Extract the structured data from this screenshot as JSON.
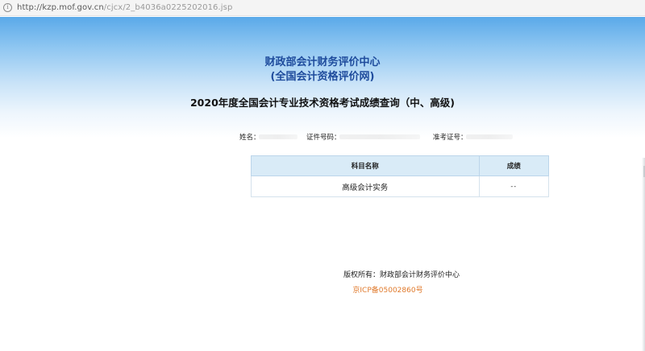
{
  "browser": {
    "url_host": "http://kzp.mof.gov.cn",
    "url_path": "/cjcx/2_b4036a0225202016.jsp"
  },
  "header": {
    "org_line1": "财政部会计财务评价中心",
    "org_line2": "(全国会计资格评价网)",
    "title": "2020年度全国会计专业技术资格考试成绩查询（中、高级)"
  },
  "candidate": {
    "name_label": "姓名：",
    "id_label": "证件号码：",
    "ticket_label": "准考证号："
  },
  "table": {
    "headers": [
      "科目名称",
      "成绩"
    ],
    "rows": [
      {
        "subject": "高级会计实务",
        "score": "--"
      }
    ]
  },
  "footer": {
    "copyright": "版权所有：财政部会计财务评价中心",
    "icp": "京ICP备05002860号"
  },
  "colors": {
    "header_blue": "#1e4b9c",
    "table_header_bg": "#d9ebf7",
    "icp_orange": "#e07a2c",
    "banner_gradient_top": "#5aa9e9"
  }
}
